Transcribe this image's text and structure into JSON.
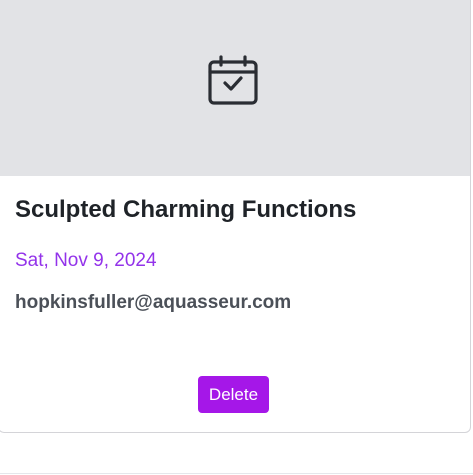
{
  "card": {
    "hero_icon": "calendar-check-icon",
    "title": "Sculpted Charming Functions",
    "date": "Sat, Nov 9, 2024",
    "email": "hopkinsfuller@aquasseur.com",
    "delete_label": "Delete"
  },
  "colors": {
    "accent": "#a517e8",
    "date_text": "#9333ea",
    "hero_bg": "#e2e3e6"
  }
}
